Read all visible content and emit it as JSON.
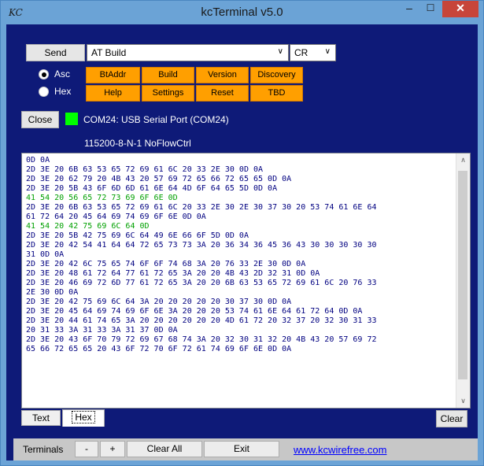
{
  "window": {
    "app_icon_text": "KC",
    "title": "kcTerminal v5.0",
    "min_glyph": "–",
    "max_glyph": "☐",
    "close_glyph": "✕"
  },
  "controls": {
    "send_label": "Send",
    "command_value": "AT Build",
    "line_end_value": "CR",
    "chevron_glyph": "∨",
    "asc_label": "Asc",
    "hex_label": "Hex",
    "asc_selected": true,
    "quick_buttons_row1": [
      "BtAddr",
      "Build",
      "Version",
      "Discovery"
    ],
    "quick_buttons_row2": [
      "Help",
      "Settings",
      "Reset",
      "TBD"
    ],
    "close_label": "Close",
    "port_text": "COM24:  USB Serial Port (COM24)",
    "port_status_color": "#00ff00",
    "serial_settings": "115200-8-N-1 NoFlowCtrl"
  },
  "terminal": {
    "lines": [
      {
        "text": "0D 0A",
        "color": "blue"
      },
      {
        "text": "2D 3E 20 6B 63 53 65 72 69 61 6C 20 33 2E 30 0D 0A",
        "color": "blue"
      },
      {
        "text": "2D 3E 20 62 79 20 4B 43 20 57 69 72 65 66 72 65 65 0D 0A",
        "color": "blue"
      },
      {
        "text": "2D 3E 20 5B 43 6F 6D 6D 61 6E 64 4D 6F 64 65 5D 0D 0A",
        "color": "blue"
      },
      {
        "text": "41 54 20 56 65 72 73 69 6F 6E 0D",
        "color": "green"
      },
      {
        "text": "2D 3E 20 6B 63 53 65 72 69 61 6C 20 33 2E 30 2E 30 37 30 20 53 74 61 6E 64",
        "color": "blue"
      },
      {
        "text": "61 72 64 20 45 64 69 74 69 6F 6E 0D 0A",
        "color": "blue"
      },
      {
        "text": "41 54 20 42 75 69 6C 64 0D",
        "color": "green"
      },
      {
        "text": "2D 3E 20 5B 42 75 69 6C 64 49 6E 66 6F 5D 0D 0A",
        "color": "blue"
      },
      {
        "text": "2D 3E 20 42 54 41 64 64 72 65 73 73 3A 20 36 34 36 45 36 43 30 30 30 30 30",
        "color": "blue"
      },
      {
        "text": "31 0D 0A",
        "color": "blue"
      },
      {
        "text": "2D 3E 20 42 6C 75 65 74 6F 6F 74 68 3A 20 76 33 2E 30 0D 0A",
        "color": "blue"
      },
      {
        "text": "2D 3E 20 48 61 72 64 77 61 72 65 3A 20 20 4B 43 2D 32 31 0D 0A",
        "color": "blue"
      },
      {
        "text": "2D 3E 20 46 69 72 6D 77 61 72 65 3A 20 20 6B 63 53 65 72 69 61 6C 20 76 33",
        "color": "blue"
      },
      {
        "text": "2E 30 0D 0A",
        "color": "blue"
      },
      {
        "text": "2D 3E 20 42 75 69 6C 64 3A 20 20 20 20 20 30 37 30 0D 0A",
        "color": "blue"
      },
      {
        "text": "2D 3E 20 45 64 69 74 69 6F 6E 3A 20 20 20 53 74 61 6E 64 61 72 64 0D 0A",
        "color": "blue"
      },
      {
        "text": "2D 3E 20 44 61 74 65 3A 20 20 20 20 20 20 4D 61 72 20 32 37 20 32 30 31 33",
        "color": "blue"
      },
      {
        "text": "20 31 33 3A 31 33 3A 31 37 0D 0A",
        "color": "blue"
      },
      {
        "text": "2D 3E 20 43 6F 70 79 72 69 67 68 74 3A 20 32 30 31 32 20 4B 43 20 57 69 72",
        "color": "blue"
      },
      {
        "text": "65 66 72 65 65 20 43 6F 72 70 6F 72 61 74 69 6F 6E 0D 0A",
        "color": "blue"
      }
    ],
    "scroll_up_glyph": "∧",
    "scroll_down_glyph": "∨"
  },
  "tabs": {
    "text_label": "Text",
    "hex_label": "Hex",
    "clear_label": "Clear"
  },
  "statusbar": {
    "terminals_label": "Terminals",
    "minus_label": "-",
    "plus_label": "+",
    "clear_all_label": "Clear All",
    "exit_label": "Exit",
    "link_text": "www.kcwirefree.com"
  }
}
